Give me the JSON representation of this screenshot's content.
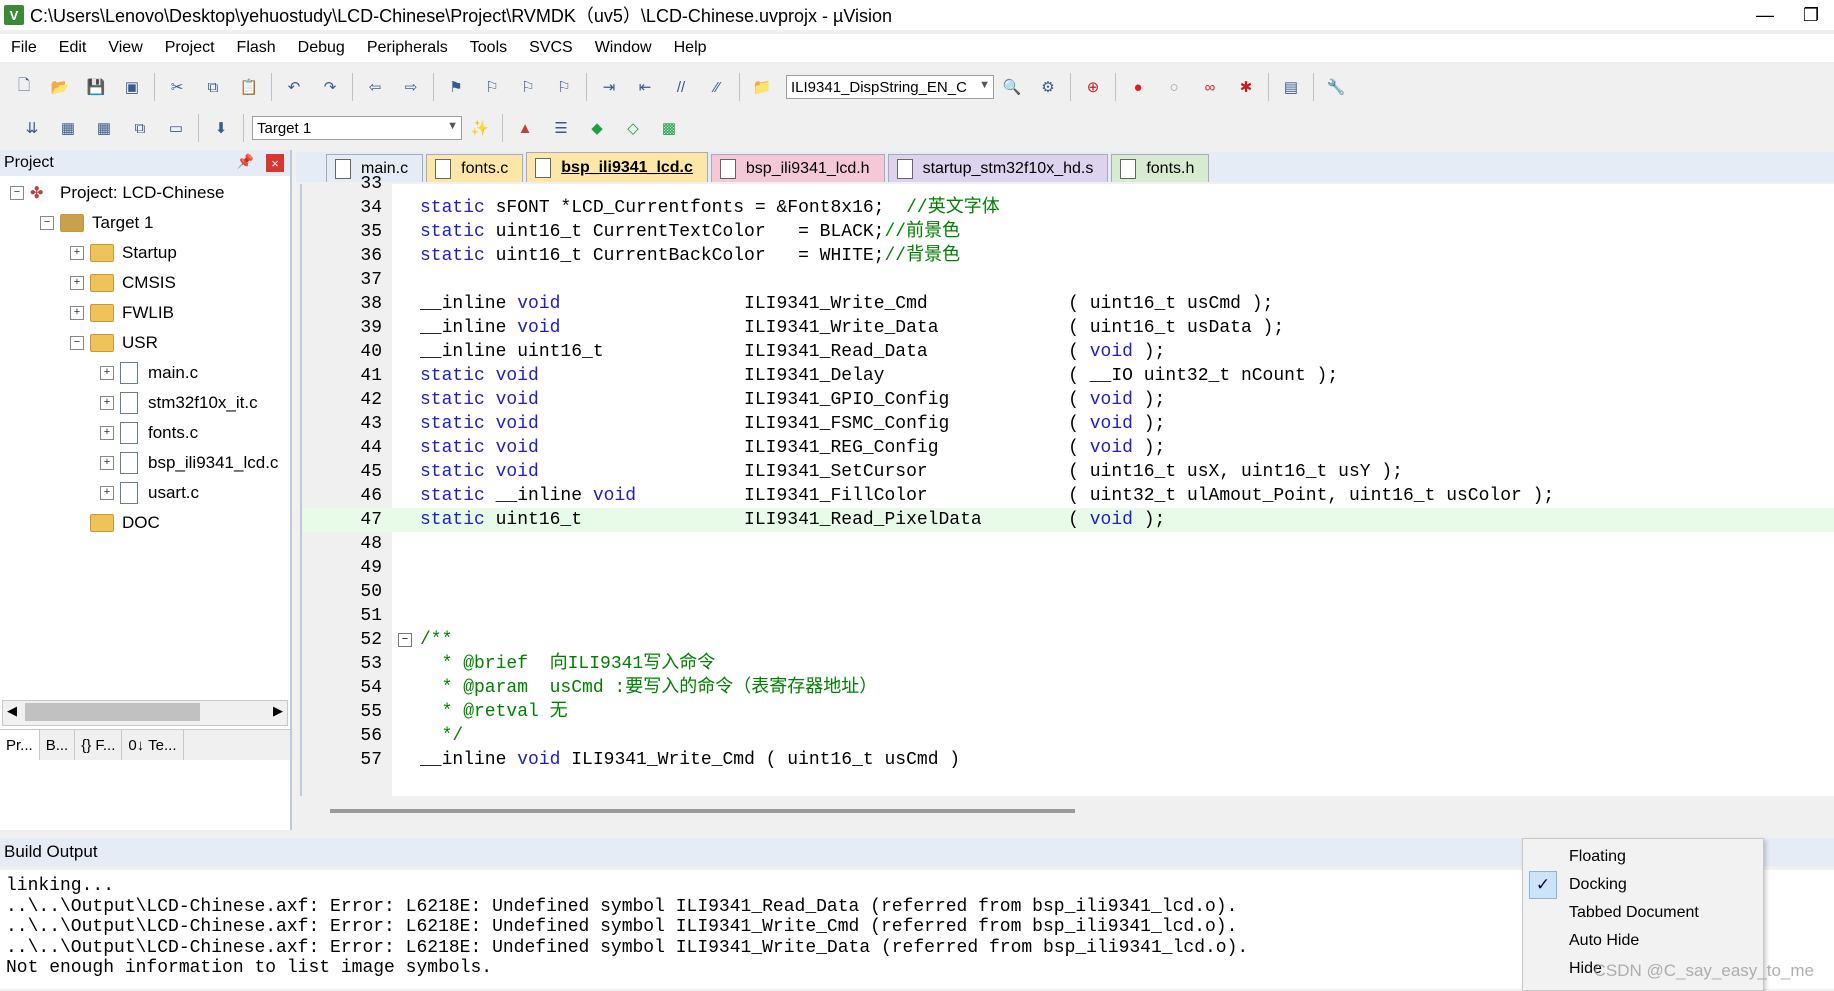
{
  "window": {
    "title": "C:\\Users\\Lenovo\\Desktop\\yehuostudy\\LCD-Chinese\\Project\\RVMDK（uv5）\\LCD-Chinese.uvprojx - µVision",
    "app_icon": "V"
  },
  "menu": [
    "File",
    "Edit",
    "View",
    "Project",
    "Flash",
    "Debug",
    "Peripherals",
    "Tools",
    "SVCS",
    "Window",
    "Help"
  ],
  "toolbar": {
    "find_combo": "ILI9341_DispString_EN_C",
    "target_combo": "Target 1"
  },
  "project_panel": {
    "title": "Project",
    "tree": [
      {
        "label": "Project: LCD-Chinese",
        "kind": "project",
        "depth": 0,
        "expander": "−"
      },
      {
        "label": "Target 1",
        "kind": "target",
        "depth": 1,
        "expander": "−"
      },
      {
        "label": "Startup",
        "kind": "folder",
        "depth": 2,
        "expander": "+"
      },
      {
        "label": "CMSIS",
        "kind": "folder",
        "depth": 2,
        "expander": "+"
      },
      {
        "label": "FWLIB",
        "kind": "folder",
        "depth": 2,
        "expander": "+"
      },
      {
        "label": "USR",
        "kind": "folder",
        "depth": 2,
        "expander": "−"
      },
      {
        "label": "main.c",
        "kind": "file",
        "depth": 3,
        "expander": "+"
      },
      {
        "label": "stm32f10x_it.c",
        "kind": "file",
        "depth": 3,
        "expander": "+"
      },
      {
        "label": "fonts.c",
        "kind": "file",
        "depth": 3,
        "expander": "+"
      },
      {
        "label": "bsp_ili9341_lcd.c",
        "kind": "file",
        "depth": 3,
        "expander": "+"
      },
      {
        "label": "usart.c",
        "kind": "file",
        "depth": 3,
        "expander": "+"
      },
      {
        "label": "DOC",
        "kind": "folder",
        "depth": 2,
        "expander": ""
      }
    ],
    "bottom_tabs": [
      "Pr...",
      "B...",
      "{} F...",
      "0↓ Te..."
    ]
  },
  "editor": {
    "tabs": [
      {
        "label": "main.c",
        "active": false,
        "color": "#e6ecf5"
      },
      {
        "label": "fonts.c",
        "active": false,
        "color": "#fde7a8"
      },
      {
        "label": "bsp_ili9341_lcd.c",
        "active": true,
        "color": "#fde7a8"
      },
      {
        "label": "bsp_ili9341_lcd.h",
        "active": false,
        "color": "#f5c8d8"
      },
      {
        "label": "startup_stm32f10x_hd.s",
        "active": false,
        "color": "#ddd3ee"
      },
      {
        "label": "fonts.h",
        "active": false,
        "color": "#d6ebcf"
      }
    ],
    "lines": [
      {
        "n": "33",
        "s": []
      },
      {
        "n": "34",
        "s": [
          {
            "t": "static",
            "c": "kw"
          },
          {
            "t": " sFONT *LCD_Currentfonts = &Font8x16;  "
          },
          {
            "t": "//英文字体",
            "c": "cm"
          }
        ]
      },
      {
        "n": "35",
        "s": [
          {
            "t": "static",
            "c": "kw"
          },
          {
            "t": " uint16_t CurrentTextColor   = BLACK;"
          },
          {
            "t": "//前景色",
            "c": "cm"
          }
        ]
      },
      {
        "n": "36",
        "s": [
          {
            "t": "static",
            "c": "kw"
          },
          {
            "t": " uint16_t CurrentBackColor   = WHITE;"
          },
          {
            "t": "//背景色",
            "c": "cm"
          }
        ]
      },
      {
        "n": "37",
        "s": []
      },
      {
        "n": "38",
        "s": [
          {
            "t": "__inline "
          },
          {
            "t": "void",
            "c": "kw"
          },
          {
            "t": "                 ILI9341_Write_Cmd             ( uint16_t usCmd );"
          }
        ]
      },
      {
        "n": "39",
        "s": [
          {
            "t": "__inline "
          },
          {
            "t": "void",
            "c": "kw"
          },
          {
            "t": "                 ILI9341_Write_Data            ( uint16_t usData );"
          }
        ]
      },
      {
        "n": "40",
        "s": [
          {
            "t": "__inline uint16_t             ILI9341_Read_Data             ( "
          },
          {
            "t": "void",
            "c": "kw"
          },
          {
            "t": " );"
          }
        ]
      },
      {
        "n": "41",
        "s": [
          {
            "t": "static void",
            "c": "kw"
          },
          {
            "t": "                   ILI9341_Delay                 ( __IO uint32_t nCount );"
          }
        ]
      },
      {
        "n": "42",
        "s": [
          {
            "t": "static void",
            "c": "kw"
          },
          {
            "t": "                   ILI9341_GPIO_Config           ( "
          },
          {
            "t": "void",
            "c": "kw"
          },
          {
            "t": " );"
          }
        ]
      },
      {
        "n": "43",
        "s": [
          {
            "t": "static void",
            "c": "kw"
          },
          {
            "t": "                   ILI9341_FSMC_Config           ( "
          },
          {
            "t": "void",
            "c": "kw"
          },
          {
            "t": " );"
          }
        ]
      },
      {
        "n": "44",
        "s": [
          {
            "t": "static void",
            "c": "kw"
          },
          {
            "t": "                   ILI9341_REG_Config            ( "
          },
          {
            "t": "void",
            "c": "kw"
          },
          {
            "t": " );"
          }
        ]
      },
      {
        "n": "45",
        "s": [
          {
            "t": "static void",
            "c": "kw"
          },
          {
            "t": "                   ILI9341_SetCursor             ( uint16_t usX, uint16_t usY );"
          }
        ]
      },
      {
        "n": "46",
        "s": [
          {
            "t": "static",
            "c": "kw"
          },
          {
            "t": " __inline "
          },
          {
            "t": "void",
            "c": "kw"
          },
          {
            "t": "          ILI9341_FillColor             ( uint32_t ulAmout_Point, uint16_t usColor );"
          }
        ]
      },
      {
        "n": "47",
        "s": [
          {
            "t": "static",
            "c": "kw"
          },
          {
            "t": " uint16_t               ILI9341_Read_PixelData        ( "
          },
          {
            "t": "void",
            "c": "kw"
          },
          {
            "t": " );"
          }
        ],
        "highlight": true
      },
      {
        "n": "48",
        "s": []
      },
      {
        "n": "49",
        "s": []
      },
      {
        "n": "50",
        "s": []
      },
      {
        "n": "51",
        "s": []
      },
      {
        "n": "52",
        "s": [
          {
            "t": "/**",
            "c": "cm"
          }
        ],
        "fold": "−"
      },
      {
        "n": "53",
        "s": [
          {
            "t": "  * @brief  向ILI9341写入命令",
            "c": "cm"
          }
        ]
      },
      {
        "n": "54",
        "s": [
          {
            "t": "  * @param  usCmd :要写入的命令（表寄存器地址）",
            "c": "cm"
          }
        ]
      },
      {
        "n": "55",
        "s": [
          {
            "t": "  * @retval 无",
            "c": "cm"
          }
        ]
      },
      {
        "n": "56",
        "s": [
          {
            "t": "  */",
            "c": "cm"
          }
        ]
      },
      {
        "n": "57",
        "s": [
          {
            "t": "__inline "
          },
          {
            "t": "void",
            "c": "kw"
          },
          {
            "t": " ILI9341_Write_Cmd ( uint16_t usCmd )"
          }
        ]
      }
    ]
  },
  "build_output": {
    "title": "Build Output",
    "lines": [
      "linking...",
      "..\\..\\Output\\LCD-Chinese.axf: Error: L6218E: Undefined symbol ILI9341_Read_Data (referred from bsp_ili9341_lcd.o).",
      "..\\..\\Output\\LCD-Chinese.axf: Error: L6218E: Undefined symbol ILI9341_Write_Cmd (referred from bsp_ili9341_lcd.o).",
      "..\\..\\Output\\LCD-Chinese.axf: Error: L6218E: Undefined symbol ILI9341_Write_Data (referred from bsp_ili9341_lcd.o).",
      "Not enough information to list image symbols."
    ]
  },
  "context_menu": {
    "items": [
      "Floating",
      "Docking",
      "Tabbed Document",
      "Auto Hide",
      "Hide"
    ],
    "checked": "Docking"
  },
  "watermark": "CSDN @C_say_easy_to_me"
}
